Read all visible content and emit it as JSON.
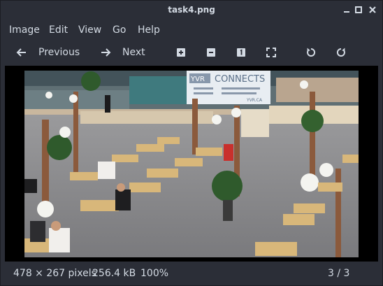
{
  "window": {
    "title": "task4.png"
  },
  "menu": {
    "items": [
      "Image",
      "Edit",
      "View",
      "Go",
      "Help"
    ]
  },
  "toolbar": {
    "previous_label": "Previous",
    "next_label": "Next"
  },
  "image": {
    "sign_title": "CONNECTS",
    "sign_brand": "YVR",
    "sign_url": "YVR.CA"
  },
  "status": {
    "dimensions": "478 × 267 pixels",
    "size": "256.4 kB",
    "zoom": "100%",
    "position": "3 / 3"
  },
  "colors": {
    "background": "#2b2e37",
    "text": "#d3dae3",
    "viewer_background": "#000000"
  },
  "icons": {
    "minimize": "minimize-icon",
    "maximize": "maximize-icon",
    "close": "close-icon",
    "previous": "arrow-left-icon",
    "next": "arrow-right-icon",
    "zoom_in": "zoom-in-icon",
    "zoom_out": "zoom-out-icon",
    "original_size": "zoom-original-icon",
    "fit": "zoom-fit-icon",
    "rotate_left": "rotate-left-icon",
    "rotate_right": "rotate-right-icon"
  }
}
